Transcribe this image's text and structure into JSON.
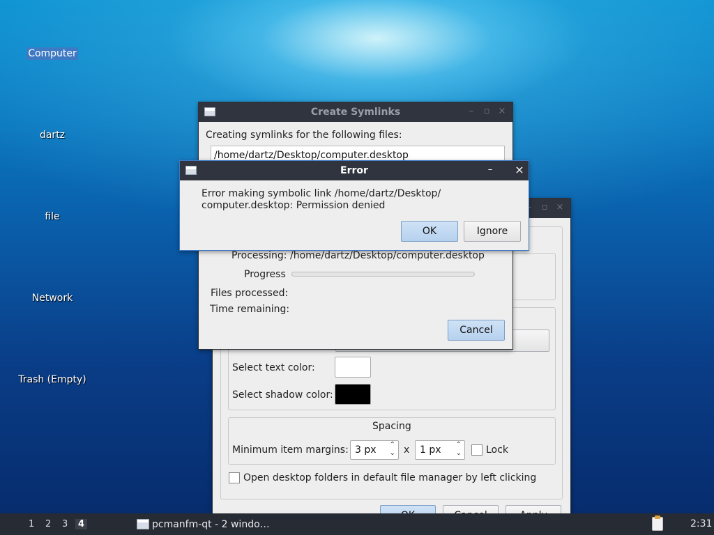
{
  "desktop": {
    "icons": [
      {
        "label": "Computer",
        "selected": true
      },
      {
        "label": "dartz"
      },
      {
        "label": "file"
      },
      {
        "label": "Network"
      },
      {
        "label": "Trash (Empty)"
      }
    ]
  },
  "prefs_dialog": {
    "text_color_label": "Select text color:",
    "text_color": "#ffffff",
    "shadow_color_label": "Select shadow color:",
    "shadow_color": "#000000",
    "spacing_title": "Spacing",
    "margins_label": "Minimum item margins:",
    "margin_x": "3 px",
    "times": "x",
    "margin_y": "1 px",
    "lock_label": "Lock",
    "open_folders_label": "Open desktop folders in default file manager by left clicking",
    "buttons": [
      "OK",
      "Cancel",
      "Apply"
    ]
  },
  "symlinks_dialog": {
    "title": "Create Symlinks",
    "intro": "Creating symlinks for the following files:",
    "file_path": "/home/dartz/Desktop/computer.desktop",
    "processing_label": "Processing:",
    "processing_value": "/home/dartz/Desktop/computer.desktop",
    "progress_label": "Progress",
    "progress": 0,
    "files_processed_label": "Files processed:",
    "time_remaining_label": "Time remaining:",
    "cancel_label": "Cancel"
  },
  "error_dialog": {
    "title": "Error",
    "minimize_glyph": "–",
    "close_glyph": "×",
    "message_line1": "Error making symbolic link /home/dartz/Desktop/",
    "message_line2": "computer.desktop: Permission denied",
    "ok_label": "OK",
    "ignore_label": "Ignore"
  },
  "taskbar": {
    "workspaces": [
      "1",
      "2",
      "3",
      "4"
    ],
    "active_workspace": "4",
    "task_label": "pcmanfm-qt - 2 windo…",
    "clock": "2:31"
  }
}
